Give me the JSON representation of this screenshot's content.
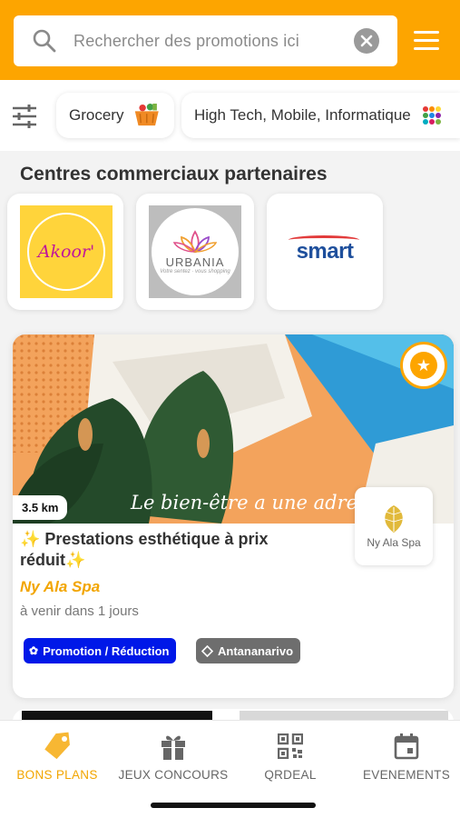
{
  "search": {
    "placeholder": "Rechercher des promotions ici"
  },
  "categories": [
    {
      "label": "Grocery",
      "icon": "shopping-basket-icon"
    },
    {
      "label": "High Tech, Mobile, Informatique",
      "icon": "colored-dots-icon"
    }
  ],
  "partners": {
    "title": "Centres commerciaux partenaires",
    "items": [
      {
        "name": "Akoor'"
      },
      {
        "name": "URBANIA",
        "tagline": "Votre sentez · vous shopping"
      },
      {
        "name": "smart"
      }
    ]
  },
  "deal": {
    "distance": "3.5 km",
    "image_caption": "Le bien-être a une adresse",
    "title": "✨ Prestations esthétique à prix réduit✨",
    "shop": "Ny Ala Spa",
    "logo_text": "Ny Ala Spa",
    "date_text": "à venir dans 1 jours",
    "badges": [
      {
        "label": "Promotion / Réduction",
        "color": "#0018e8"
      },
      {
        "label": "Antananarivo",
        "color": "#6e6e6e"
      }
    ]
  },
  "bottom_nav": [
    {
      "label": "BONS PLANS",
      "icon": "tag-icon",
      "active": true
    },
    {
      "label": "JEUX CONCOURS",
      "icon": "gift-icon",
      "active": false
    },
    {
      "label": "QRDEAL",
      "icon": "qr-code-icon",
      "active": false
    },
    {
      "label": "EVENEMENTS",
      "icon": "calendar-icon",
      "active": false
    }
  ],
  "colors": {
    "accent": "#FDA500",
    "shop_name": "#F2A500",
    "promo_badge": "#0018e8"
  }
}
